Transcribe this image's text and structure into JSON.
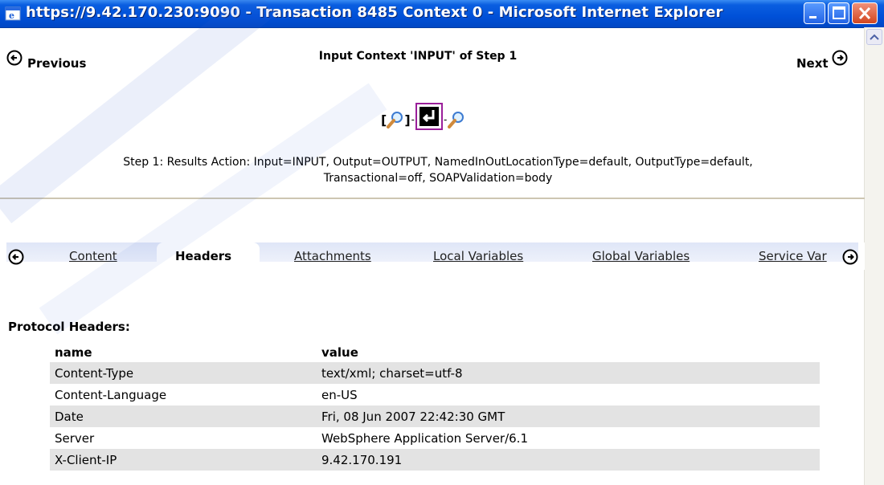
{
  "window": {
    "title": "https://9.42.170.230:9090 - Transaction 8485 Context 0 - Microsoft Internet Explorer"
  },
  "nav": {
    "previous_label": "Previous",
    "next_label": "Next",
    "page_title": "Input Context 'INPUT' of Step 1"
  },
  "toolbar": {
    "open_bracket": "[",
    "close_bracket": "]",
    "dash": "-"
  },
  "step_description": {
    "line1": "Step 1: Results Action: Input=INPUT, Output=OUTPUT, NamedInOutLocationType=default, OutputType=default,",
    "line2": "Transactional=off, SOAPValidation=body"
  },
  "tabs": [
    {
      "label": "Content",
      "active": false
    },
    {
      "label": "Headers",
      "active": true
    },
    {
      "label": "Attachments",
      "active": false
    },
    {
      "label": "Local Variables",
      "active": false
    },
    {
      "label": "Global Variables",
      "active": false
    },
    {
      "label": "Service Var",
      "active": false
    }
  ],
  "protocol_headers": {
    "title": "Protocol Headers:",
    "columns": [
      "name",
      "value"
    ],
    "rows": [
      [
        "Content-Type",
        "text/xml; charset=utf-8"
      ],
      [
        "Content-Language",
        "en-US"
      ],
      [
        "Date",
        "Fri, 08 Jun 2007 22:42:30 GMT"
      ],
      [
        "Server",
        "WebSphere Application Server/6.1"
      ],
      [
        "X-Client-IP",
        "9.42.170.191"
      ]
    ]
  },
  "colors": {
    "titlebar": "#0050d8",
    "row_shade": "#e3e3e3",
    "tab_band": "#dfe6f7"
  }
}
